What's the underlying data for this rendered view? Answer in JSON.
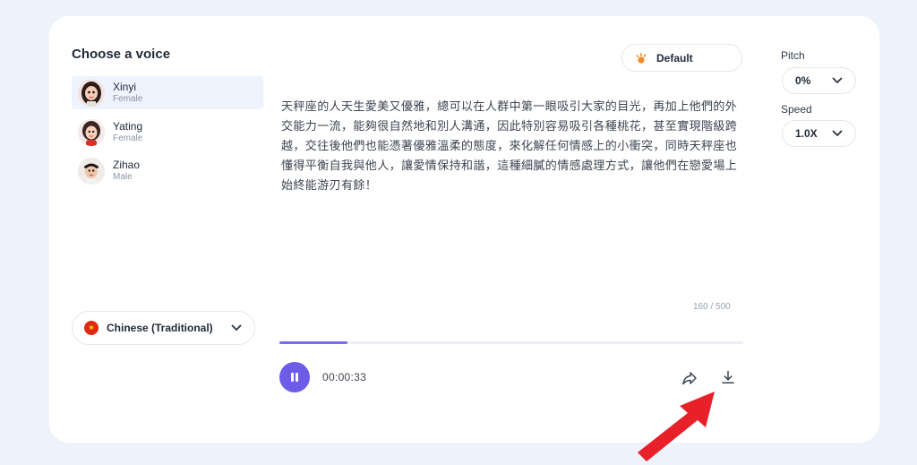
{
  "panel": {
    "title": "Choose a voice"
  },
  "voices": [
    {
      "name": "Xinyi",
      "gender": "Female",
      "selected": true
    },
    {
      "name": "Yating",
      "gender": "Female",
      "selected": false
    },
    {
      "name": "Zihao",
      "gender": "Male",
      "selected": false
    }
  ],
  "language": {
    "label": "Chinese (Traditional)",
    "icon": "china-flag-icon"
  },
  "style_button": {
    "label": "Default",
    "icon": "sparkle-icon"
  },
  "text_content": "天秤座的人天生愛美又優雅，總可以在人群中第一眼吸引大家的目光，再加上他們的外交能力一流，能夠很自然地和別人溝通，因此特別容易吸引各種桃花，甚至實現階級跨越，交往後他們也能憑著優雅溫柔的態度，來化解任何情感上的小衝突，同時天秤座也懂得平衡自我與他人，讓愛情保持和諧，這種細膩的情感處理方式，讓他們在戀愛場上始終能游刃有餘！",
  "char_count": "160 / 500",
  "player": {
    "time": "00:00:33",
    "progress": 0.146
  },
  "pitch": {
    "label": "Pitch",
    "value": "0%"
  },
  "speed": {
    "label": "Speed",
    "value": "1.0X"
  },
  "colors": {
    "accent": "#6c5ce7",
    "background": "#eef3fb",
    "arrow": "#e8202a"
  }
}
